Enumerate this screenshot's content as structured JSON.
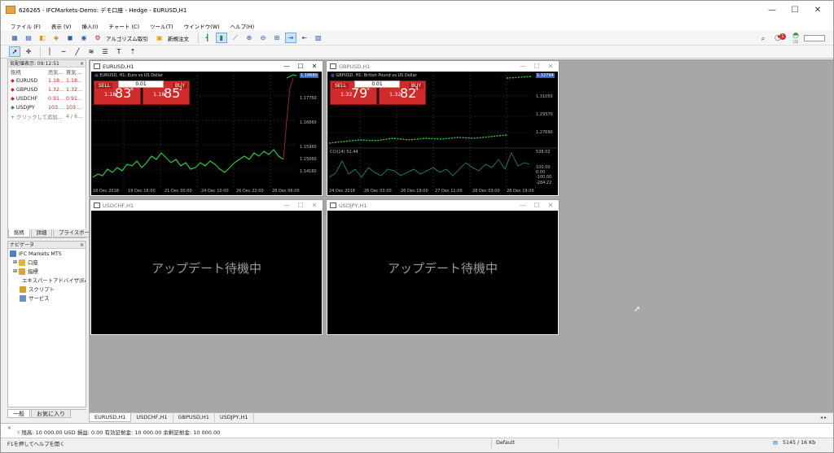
{
  "window": {
    "title": "626265 - IFCMarkets-Demo: デモ口座 - Hedge - EURUSD,H1",
    "minimize": "—",
    "maximize": "☐",
    "close": "✕"
  },
  "menu": [
    "ファイル (F)",
    "表示 (V)",
    "挿入(I)",
    "チャート (C)",
    "ツール(T)",
    "ウインドウ(W)",
    "ヘルプ(H)"
  ],
  "toolbar": {
    "algo_label": "アルゴリズム取引",
    "new_order_label": "新規注文",
    "notif_count": "1",
    "signal_label": "LTE"
  },
  "market_watch": {
    "header": "気配値表示: 09:12:51",
    "columns": [
      "銘柄",
      "売気...",
      "買気..."
    ],
    "rows": [
      {
        "symbol": "EURUSD",
        "bid": "1.18...",
        "ask": "1.18..."
      },
      {
        "symbol": "GBPUSD",
        "bid": "1.32...",
        "ask": "1.32..."
      },
      {
        "symbol": "USDCHF",
        "bid": "0.91...",
        "ask": "0.91..."
      },
      {
        "symbol": "USDJPY",
        "bid": "103....",
        "ask": "103...."
      }
    ],
    "add_label": "クリックして追加...",
    "count": "4 / 6...",
    "tabs": [
      "銘柄",
      "詳細",
      "プライスボード"
    ]
  },
  "navigator": {
    "header": "ナビゲータ",
    "root": "IFC Markets MT5",
    "items": [
      "口座",
      "指標",
      "エキスパートアドバイザ(EA",
      "スクリプト",
      "サービス"
    ],
    "tabs": [
      "一般",
      "お気に入り"
    ]
  },
  "charts": {
    "eurusd": {
      "title": "EURUSD,H1",
      "info": "EURUSD, H1:  Euro vs US Dollar",
      "sell": "SELL",
      "buy": "BUY",
      "lots": "0.01",
      "sell_price": {
        "pre": "1.18",
        "big": "83",
        "sup": "8"
      },
      "buy_price": {
        "pre": "1.18",
        "big": "85",
        "sup": "2"
      },
      "yticks": [
        "1.18680",
        "1.17760",
        "1.16860",
        "1.15960",
        "1.15060",
        "1.14160"
      ],
      "xticks": [
        "18 Dec 2018",
        "19 Dec 16:00",
        "21 Dec 00:00",
        "24 Dec 10:00",
        "26 Dec 22:00",
        "28 Dec 06:00"
      ]
    },
    "gbpusd": {
      "title": "GBPUSD,H1",
      "info": "GBPUSD, H1:  British Pound vs US Dollar",
      "sell": "SELL",
      "buy": "BUY",
      "lots": "0.01",
      "sell_price": {
        "pre": "1.32",
        "big": "79",
        "sup": "4"
      },
      "buy_price": {
        "pre": "1.32",
        "big": "82",
        "sup": "4"
      },
      "yticks": [
        "1.32794",
        "1.31050",
        "1.29370",
        "1.27690"
      ],
      "cci_label": "CCI(14) 52.44",
      "cci_ticks": [
        "538.02",
        "100.00",
        "0.00",
        "-100.00",
        "-284.22"
      ],
      "xticks": [
        "24 Dec 2018",
        "26 Dec 03:00",
        "26 Dec 19:00",
        "27 Dec 11:00",
        "28 Dec 03:00",
        "28 Dec 19:00"
      ]
    },
    "usdchf": {
      "title": "USDCHF,H1",
      "waiting": "アップデート待機中"
    },
    "usdjpy": {
      "title": "USDJPY,H1",
      "waiting": "アップデート待機中"
    }
  },
  "chart_tabs": [
    "EURUSD,H1",
    "USDCHF,H1",
    "GBPUSD,H1",
    "USDJPY,H1"
  ],
  "toolbox": {
    "balance_text": "残高: 10 000.00 USD  損益: 0.00  有効証拠金: 10 000.00  余剰証拠金: 10 000.00"
  },
  "status": {
    "help": "F1を押してヘルプを開く",
    "profile": "Default",
    "traffic": "5145 / 16 Kb"
  }
}
